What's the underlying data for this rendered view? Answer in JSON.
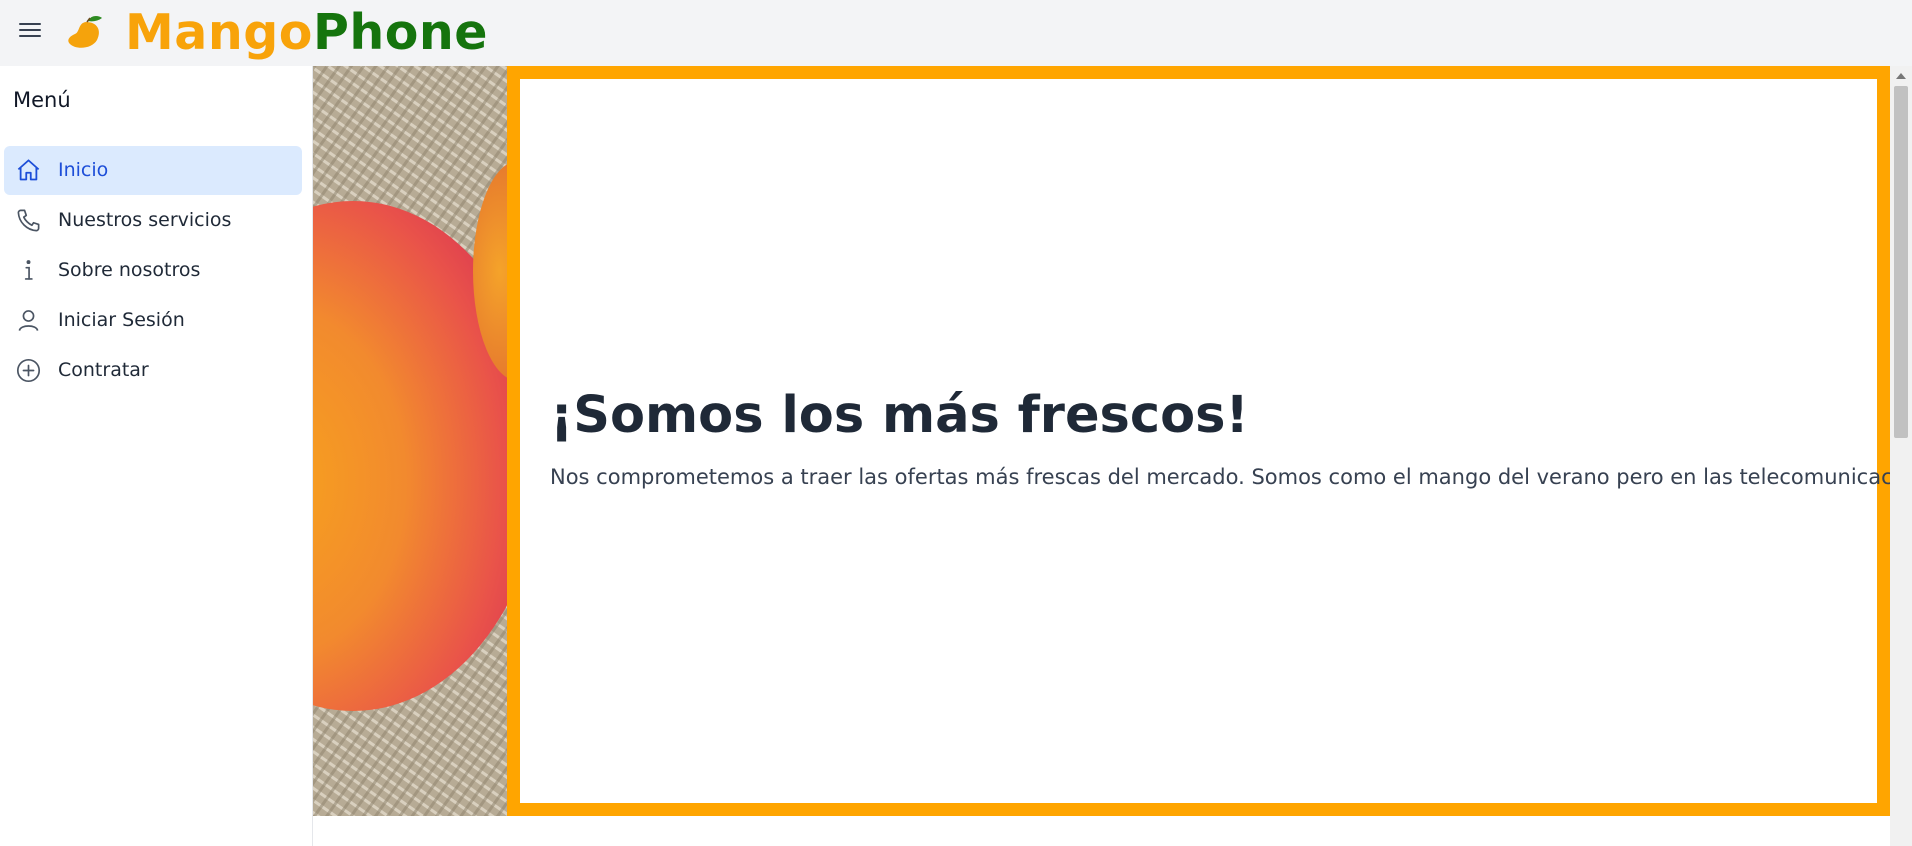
{
  "header": {
    "brand_part1": "Mango",
    "brand_part2": "Phone",
    "menu_icon": "hamburger-icon",
    "logo_icon": "mango-icon"
  },
  "sidebar": {
    "title": "Menú",
    "items": [
      {
        "label": "Inicio",
        "icon": "home-icon",
        "active": true
      },
      {
        "label": "Nuestros servicios",
        "icon": "phone-icon",
        "active": false
      },
      {
        "label": "Sobre nosotros",
        "icon": "info-icon",
        "active": false
      },
      {
        "label": "Iniciar Sesión",
        "icon": "user-icon",
        "active": false
      },
      {
        "label": "Contratar",
        "icon": "plus-circle-icon",
        "active": false
      }
    ]
  },
  "hero": {
    "title": "¡Somos los más frescos!",
    "text": "Nos comprometemos a traer las ofertas más frescas del mercado. Somos como el mango del verano pero en las telecomunicaciones"
  },
  "colors": {
    "brand_orange": "#f8a30a",
    "brand_green": "#15740d",
    "panel_border": "#ffa500",
    "active_bg": "#dbeafe",
    "active_text": "#1d4ed8"
  }
}
